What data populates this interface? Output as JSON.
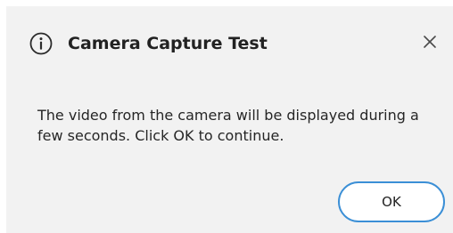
{
  "dialog": {
    "title": "Camera Capture Test",
    "title_icon": "info-circle-icon",
    "close_icon": "close-icon",
    "message": "The video from the camera will be displayed during a few seconds. Click OK to continue.",
    "ok_label": "OK"
  },
  "colors": {
    "dialog_background": "#f2f2f2",
    "button_border": "#3b8fd6",
    "text": "#222222"
  }
}
